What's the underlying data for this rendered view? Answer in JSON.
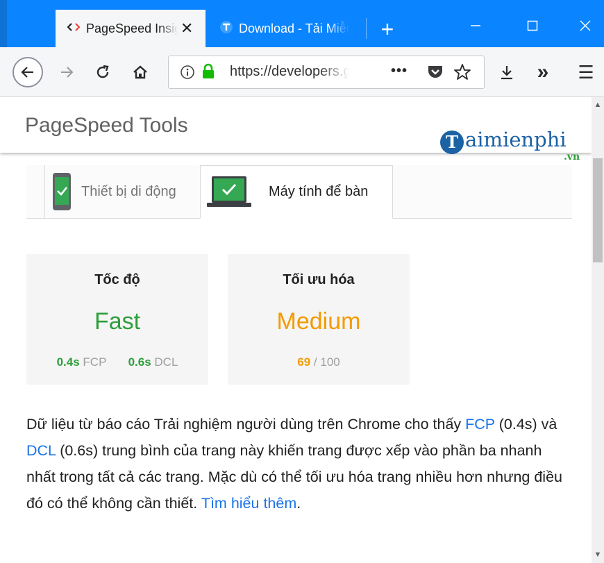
{
  "colors": {
    "titlebar": "#0a84ff",
    "fast": "#2e9e3a",
    "medium": "#f29b00",
    "link": "#1a73e8",
    "logo_blue": "#1b62a5",
    "logo_green": "#2e9c3a"
  },
  "browser": {
    "tabs": [
      {
        "icon": "code-brackets-icon",
        "title": "PageSpeed Insights"
      },
      {
        "icon": "blue-t-favicon-icon",
        "title": "Download - Tải Miễn Phí"
      }
    ],
    "new_tab_symbol": "+",
    "window_controls": {
      "minimize": "—",
      "maximize": "☐",
      "close": "✕"
    },
    "url": "https://developers.google.com/speed/pagespeed/insights/",
    "toolbar_icons": [
      "back-icon",
      "forward-icon",
      "reload-icon",
      "home-icon",
      "info-icon",
      "lock-icon",
      "page-actions-icon",
      "pocket-icon",
      "bookmark-star-icon",
      "download-icon",
      "overflow-chevron-icon",
      "menu-icon"
    ],
    "page_actions_symbol": "•••",
    "overflow_symbol": "»",
    "menu_symbol": "☰"
  },
  "page": {
    "title": "PageSpeed Tools",
    "logo": {
      "initial": "T",
      "word": "aimienphi",
      "tld": ".vn"
    },
    "device_tabs": [
      {
        "label": "Thiết bị di động",
        "icon": "phone-icon",
        "active": false
      },
      {
        "label": "Máy tính để bàn",
        "icon": "laptop-icon",
        "active": true
      }
    ],
    "speed_card": {
      "heading": "Tốc độ",
      "rating": "Fast",
      "fcp_value": "0.4s",
      "fcp_label": "FCP",
      "dcl_value": "0.6s",
      "dcl_label": "DCL"
    },
    "optimization_card": {
      "heading": "Tối ưu hóa",
      "rating": "Medium",
      "score": "69",
      "score_max": "/ 100"
    },
    "description": {
      "part1": "Dữ liệu từ báo cáo Trải nghiệm người dùng trên Chrome cho thấy ",
      "fcp_link": "FCP",
      "part2": " (0.4s) và ",
      "dcl_link": "DCL",
      "part3": " (0.6s) trung bình của trang này khiến trang được xếp vào phần ba nhanh nhất trong tất cả các trang. Mặc dù có thể tối ưu hóa trang nhiều hơn nhưng điều đó có thể không cần thiết. ",
      "learn_more": "Tìm hiểu thêm",
      "end": "."
    }
  }
}
